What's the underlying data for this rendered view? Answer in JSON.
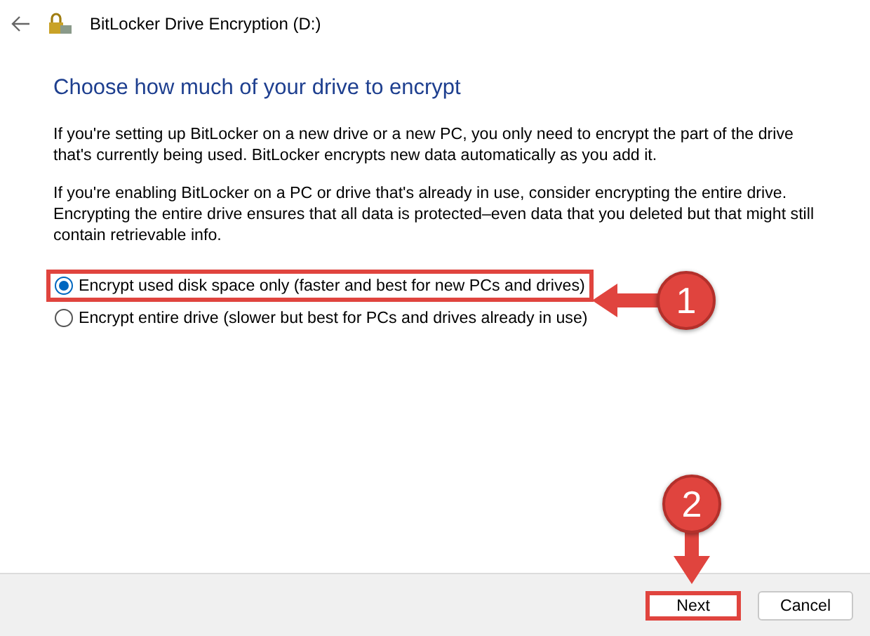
{
  "window": {
    "title": "BitLocker Drive Encryption (D:)"
  },
  "heading": "Choose how much of your drive to encrypt",
  "paragraphs": [
    "If you're setting up BitLocker on a new drive or a new PC, you only need to encrypt the part of the drive that's currently being used. BitLocker encrypts new data automatically as you add it.",
    "If you're enabling BitLocker on a PC or drive that's already in use, consider encrypting the entire drive. Encrypting the entire drive ensures that all data is protected–even data that you deleted but that might still contain retrievable info."
  ],
  "options": [
    {
      "label": "Encrypt used disk space only (faster and best for new PCs and drives)",
      "selected": true,
      "highlighted": true
    },
    {
      "label": "Encrypt entire drive (slower but best for PCs and drives already in use)",
      "selected": false,
      "highlighted": false
    }
  ],
  "buttons": [
    {
      "label": "Next",
      "highlighted": true
    },
    {
      "label": "Cancel",
      "highlighted": false
    }
  ],
  "annotations": [
    {
      "number": "1",
      "kind": "left"
    },
    {
      "number": "2",
      "kind": "down"
    }
  ]
}
